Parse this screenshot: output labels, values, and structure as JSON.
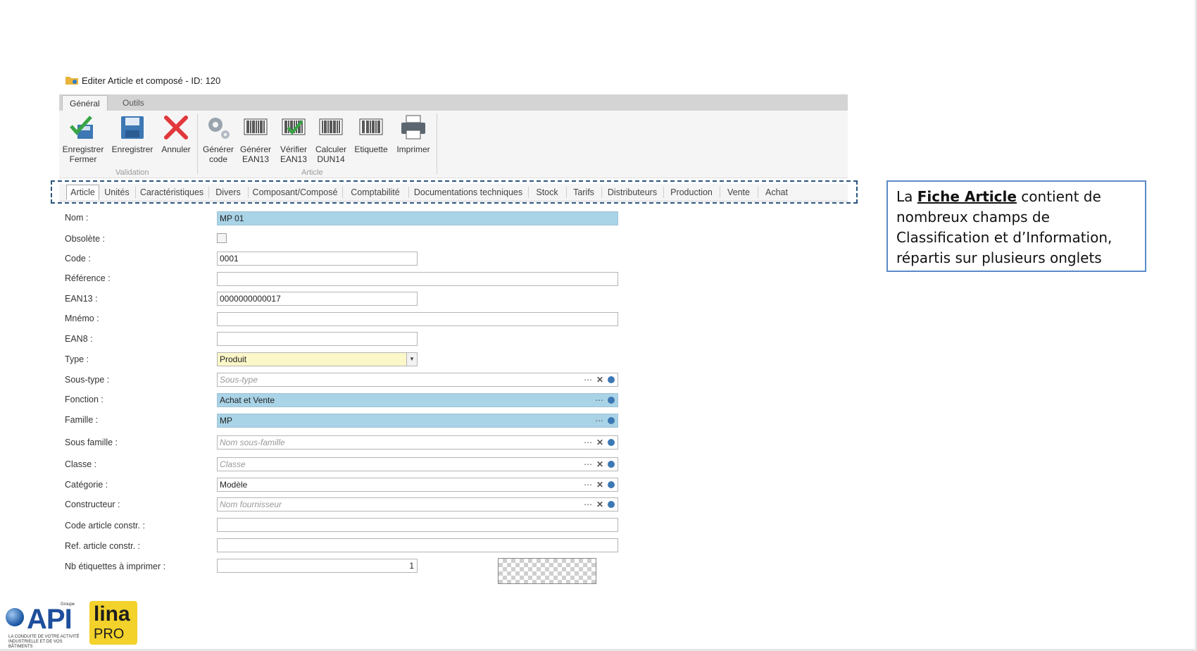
{
  "window": {
    "title": "Editer Article et composé - ID: 120"
  },
  "ribbon_tabs": [
    "Général",
    "Outils"
  ],
  "ribbon": {
    "buttons": [
      {
        "id": "enregistrer-fermer",
        "line1": "Enregistrer",
        "line2": "Fermer"
      },
      {
        "id": "enregistrer",
        "line1": "Enregistrer",
        "line2": ""
      },
      {
        "id": "annuler",
        "line1": "Annuler",
        "line2": ""
      },
      {
        "id": "generer-code",
        "line1": "Générer",
        "line2": "code"
      },
      {
        "id": "generer-ean13",
        "line1": "Générer",
        "line2": "EAN13"
      },
      {
        "id": "verifier-ean13",
        "line1": "Vérifier",
        "line2": "EAN13"
      },
      {
        "id": "calculer-dun14",
        "line1": "Calculer",
        "line2": "DUN14"
      },
      {
        "id": "etiquette",
        "line1": "Etiquette",
        "line2": ""
      },
      {
        "id": "imprimer",
        "line1": "Imprimer",
        "line2": ""
      }
    ],
    "groups": [
      "Validation",
      "Article"
    ]
  },
  "form_tabs": [
    "Article",
    "Unités",
    "Caractéristiques",
    "Divers",
    "Composant/Composé",
    "Comptabilité",
    "Documentations techniques",
    "Stock",
    "Tarifs",
    "Distributeurs",
    "Production",
    "Vente",
    "Achat"
  ],
  "form": {
    "nom": {
      "label": "Nom :",
      "value": "MP 01"
    },
    "obsolete": {
      "label": "Obsolète :",
      "checked": false
    },
    "code": {
      "label": "Code :",
      "value": "0001"
    },
    "reference": {
      "label": "Référence :",
      "value": ""
    },
    "ean13": {
      "label": "EAN13 :",
      "value": "0000000000017"
    },
    "mnemo": {
      "label": "Mnémo :",
      "value": ""
    },
    "ean8": {
      "label": "EAN8 :",
      "value": ""
    },
    "type": {
      "label": "Type :",
      "value": "Produit"
    },
    "sous_type": {
      "label": "Sous-type :",
      "placeholder": "Sous-type"
    },
    "fonction": {
      "label": "Fonction :",
      "value": "Achat et Vente"
    },
    "famille": {
      "label": "Famille :",
      "value": "MP"
    },
    "sous_famille": {
      "label": "Sous famille :",
      "placeholder": "Nom sous-famille"
    },
    "classe": {
      "label": "Classe :",
      "placeholder": "Classe"
    },
    "categorie": {
      "label": "Catégorie :",
      "value": "Modèle"
    },
    "constructeur": {
      "label": "Constructeur :",
      "placeholder": "Nom fournisseur"
    },
    "code_article_constr": {
      "label": "Code article constr. :",
      "value": ""
    },
    "ref_article_constr": {
      "label": "Ref. article constr. :",
      "value": ""
    },
    "nb_etiquettes": {
      "label": "Nb étiquettes à imprimer :",
      "value": "1"
    }
  },
  "callout": {
    "prefix": "La ",
    "bold": "Fiche Article",
    "rest": " contient de nombreux champs de Classification et d’Information, répartis sur plusieurs onglets"
  },
  "logos": {
    "api_word": "API",
    "api_groupe": "Groupe",
    "api_tagline": "LA CONDUITE DE VOTRE ACTIVITÉ INDUSTRIELLE ET DE VOS BÂTIMENTS",
    "lina_word": "lina",
    "lina_pro": "PRO"
  },
  "colors": {
    "accent_blue": "#a9d3e6",
    "type_yellow": "#fbf7c8",
    "callout_border": "#5b8ac9",
    "dashed_border": "#2b5581"
  }
}
